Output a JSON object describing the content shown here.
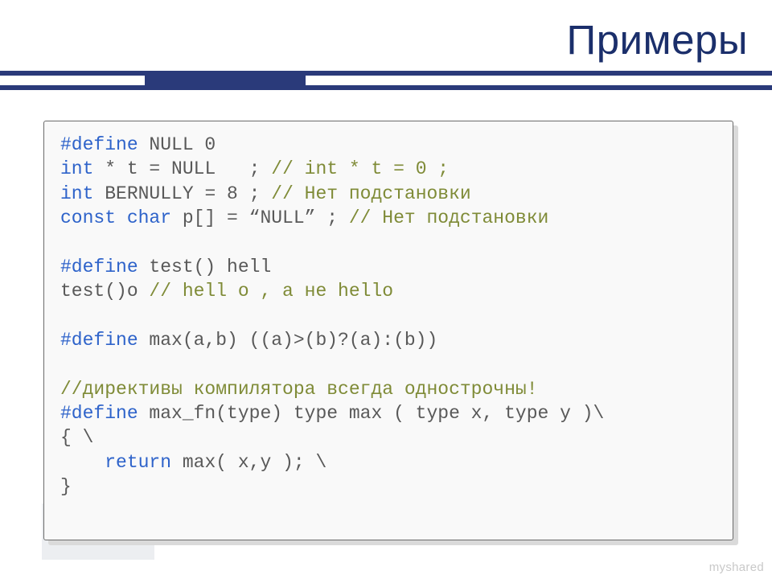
{
  "title": "Примеры",
  "watermark": "myshared",
  "code": {
    "line1": {
      "kw": "#define ",
      "body": "NULL 0"
    },
    "line2": {
      "kw": "int ",
      "body": "* t = NULL   ; ",
      "c": "// int * t = 0 ;"
    },
    "line3": {
      "kw": "int ",
      "body": "BERNULLY = 8 ; ",
      "c": "// Нет подстановки"
    },
    "line4": {
      "kw": "const char ",
      "body": "p[] = “NULL” ; ",
      "c": "// Нет подстановки"
    },
    "line5": "",
    "line6": {
      "kw": "#define ",
      "body": "test() hell"
    },
    "line7": {
      "body": "test()o ",
      "c": "// hell o , а не hello"
    },
    "line8": "",
    "line9": {
      "kw": "#define ",
      "body": "max(a,b) ((a)>(b)?(a):(b))"
    },
    "line10": "",
    "line11": {
      "c": "//директивы компилятора всегда однострочны!"
    },
    "line12": {
      "kw": "#define ",
      "body": "max_fn(type) type max ( type x, type y )\\"
    },
    "line13": {
      "body": "{ \\"
    },
    "line14": {
      "indent": "    ",
      "kw": "return ",
      "body": "max( x,y ); \\"
    },
    "line15": {
      "body": "}"
    }
  }
}
